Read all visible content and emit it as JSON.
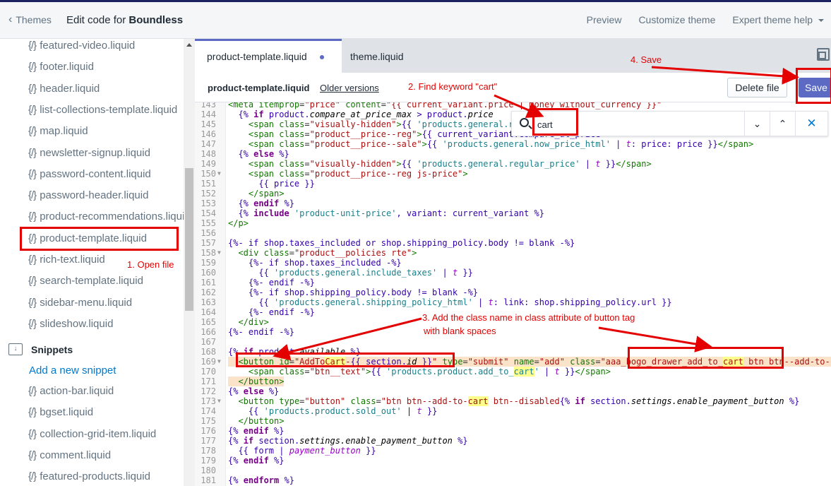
{
  "header": {
    "back_label": "Themes",
    "title_prefix": "Edit code for ",
    "title_theme": "Boundless",
    "nav": [
      "Preview",
      "Customize theme",
      "Expert theme help"
    ]
  },
  "sidebar": {
    "sections_files": [
      "featured-video.liquid",
      "footer.liquid",
      "header.liquid",
      "list-collections-template.liquid",
      "map.liquid",
      "newsletter-signup.liquid",
      "password-content.liquid",
      "password-header.liquid",
      "product-recommendations.liquid",
      "product-template.liquid",
      "rich-text.liquid",
      "search-template.liquid",
      "sidebar-menu.liquid",
      "slideshow.liquid"
    ],
    "snippets_folder": "Snippets",
    "add_snippet": "Add a new snippet",
    "snippet_files": [
      "action-bar.liquid",
      "bgset.liquid",
      "collection-grid-item.liquid",
      "comment.liquid",
      "featured-products.liquid"
    ],
    "code_icon": "{/}"
  },
  "editor": {
    "tabs": [
      {
        "label": "product-template.liquid",
        "active": true,
        "unsaved": true
      },
      {
        "label": "theme.liquid",
        "active": false
      }
    ],
    "file_name": "product-template.liquid",
    "older_versions": "Older versions",
    "delete_label": "Delete file",
    "save_label": "Save",
    "search": {
      "value": "cart",
      "next": "⌄",
      "prev": "⌃",
      "close": "✕"
    },
    "lines": [
      {
        "n": "143",
        "html": "<span class='tag'>&lt;meta</span> <span class='attr'>itemprop</span>=<span class='str'>\"price\"</span> <span class='attr'>content</span>=<span class='str'>\"{{ current_variant.price | money_without_currency }}\"</span>"
      },
      {
        "n": "144",
        "html": "  <span class='lq'>{%</span> <span class='kw'>if</span> <span class='lq'>product.</span><span class='prop'>compare_at_price_max</span> <span class='lq'>&gt; product.</span><span class='prop'>price</span>"
      },
      {
        "n": "145",
        "html": "    <span class='tag'>&lt;span</span> <span class='attr'>class</span>=<span class='str'>\"visually-hidden\"</span><span class='tag'>&gt;</span><span class='lq'>{{</span> <span class='q'>'products.general.regular_price'</span>"
      },
      {
        "n": "146",
        "html": "    <span class='tag'>&lt;span</span> <span class='attr'>class</span>=<span class='str'>\"product__price--reg\"</span><span class='tag'>&gt;</span><span class='lq'>{{ current_variant.compare_at_price</span>"
      },
      {
        "n": "147",
        "html": "    <span class='tag'>&lt;span</span> <span class='attr'>class</span>=<span class='str'>\"product__price--sale\"</span><span class='tag'>&gt;</span><span class='lq'>{{</span> <span class='q'>'products.general.now_price_html'</span> <span class='lq'>|</span> <span class='filter'>t</span><span class='lq'>: price: price }}</span><span class='tag'>&lt;/span&gt;</span>"
      },
      {
        "n": "148",
        "html": "  <span class='lq'>{%</span> <span class='kw'>else</span> <span class='lq'>%}</span>"
      },
      {
        "n": "149",
        "html": "    <span class='tag'>&lt;span</span> <span class='attr'>class</span>=<span class='str'>\"visually-hidden\"</span><span class='tag'>&gt;</span><span class='lq'>{{</span> <span class='q'>'products.general.regular_price'</span> <span class='lq'>|</span> <span class='filter'>t</span> <span class='lq'>}}</span><span class='tag'>&lt;/span&gt;</span>"
      },
      {
        "n": "150",
        "fold": true,
        "html": "    <span class='tag'>&lt;span</span> <span class='attr'>class</span>=<span class='str'>\"product__price--reg js-price\"</span><span class='tag'>&gt;</span>"
      },
      {
        "n": "151",
        "html": "      <span class='lq'>{{ price }}</span>"
      },
      {
        "n": "152",
        "html": "    <span class='tag'>&lt;/span&gt;</span>"
      },
      {
        "n": "153",
        "html": "  <span class='lq'>{%</span> <span class='kw'>endif</span> <span class='lq'>%}</span>"
      },
      {
        "n": "154",
        "html": "  <span class='lq'>{%</span> <span class='kw'>include</span> <span class='q'>'product-unit-price'</span><span class='lq'>, variant: current_variant %}</span>"
      },
      {
        "n": "155",
        "html": "<span class='tag'>&lt;/p&gt;</span>"
      },
      {
        "n": "156",
        "html": ""
      },
      {
        "n": "157",
        "html": "<span class='lq'>{%- if shop.taxes_included or shop.shipping_policy.body != blank -%}</span>"
      },
      {
        "n": "158",
        "fold": true,
        "html": "  <span class='tag'>&lt;div</span> <span class='attr'>class</span>=<span class='str'>\"product__policies rte\"</span><span class='tag'>&gt;</span>"
      },
      {
        "n": "159",
        "html": "    <span class='lq'>{%- if shop.taxes_included -%}</span>"
      },
      {
        "n": "160",
        "html": "      <span class='lq'>{{</span> <span class='q'>'products.general.include_taxes'</span> <span class='lq'>|</span> <span class='filter'>t</span> <span class='lq'>}}</span>"
      },
      {
        "n": "161",
        "html": "    <span class='lq'>{%- endif -%}</span>"
      },
      {
        "n": "162",
        "html": "    <span class='lq'>{%- if shop.shipping_policy.body != blank -%}</span>"
      },
      {
        "n": "163",
        "html": "      <span class='lq'>{{</span> <span class='q'>'products.general.shipping_policy_html'</span> <span class='lq'>|</span> <span class='filter'>t</span><span class='lq'>: link: shop.shipping_policy.url }}</span>"
      },
      {
        "n": "164",
        "html": "    <span class='lq'>{%- endif -%}</span>"
      },
      {
        "n": "165",
        "html": "  <span class='tag'>&lt;/div&gt;</span>"
      },
      {
        "n": "166",
        "html": "<span class='lq'>{%- endif -%}</span>"
      },
      {
        "n": "167",
        "html": ""
      },
      {
        "n": "168",
        "html": "<span class='lq'>{%</span> <span class='kw'>if</span> <span class='lq'>product.</span><span class='prop'>available</span> <span class='lq'>%}</span>"
      },
      {
        "n": "169",
        "fold": true,
        "hl": true,
        "html": "  <span class='tag'>&lt;button</span> <span class='attr'>id</span>=<span class='str'>\"AddTo<span class='match'>Cart</span>-</span><span class='lq'>{{ section.</span><span class='prop'>id</span> <span class='lq'>}}</span><span class='str'>\"</span> <span class='attr'>type</span>=<span class='str'>\"submit\"</span> <span class='attr'>name</span>=<span class='str'>\"add\"</span> <span class='attr'>class</span>=<span class='str'>\"aaa_bogo_drawer_add_to_<span class='match'>cart</span> btn btn--add-to-cart\"</span>"
      },
      {
        "n": "170",
        "html": "    <span class='tag'>&lt;span</span> <span class='attr'>class</span>=<span class='str'>\"btn__text\"</span><span class='tag'>&gt;</span><span class='lq'>{{</span> <span class='q'>'products.product.add_to_<span class='match'>cart</span>'</span> <span class='lq'>|</span> <span class='filter'>t</span> <span class='lq'>}}</span><span class='tag'>&lt;/span&gt;</span>"
      },
      {
        "n": "171",
        "hl": true,
        "html": "  <span class='tag'>&lt;/button&gt;</span>"
      },
      {
        "n": "172",
        "html": "<span class='lq'>{%</span> <span class='kw'>else</span> <span class='lq'>%}</span>"
      },
      {
        "n": "173",
        "fold": true,
        "html": "  <span class='tag'>&lt;button</span> <span class='attr'>type</span>=<span class='str'>\"button\"</span> <span class='attr'>class</span>=<span class='str'>\"btn btn--add-to-<span class='match'>cart</span> btn--disabled</span><span class='lq'>{%</span> <span class='kw'>if</span> <span class='lq'>section.</span><span class='prop'>settings.enable_payment_button</span> <span class='lq'>%}</span>"
      },
      {
        "n": "174",
        "html": "    <span class='lq'>{{</span> <span class='q'>'products.product.sold_out'</span> <span class='lq'>|</span> <span class='filter'>t</span> <span class='lq'>}}</span>"
      },
      {
        "n": "175",
        "html": "  <span class='tag'>&lt;/button&gt;</span>"
      },
      {
        "n": "176",
        "html": "<span class='lq'>{%</span> <span class='kw'>endif</span> <span class='lq'>%}</span>"
      },
      {
        "n": "177",
        "html": "<span class='lq'>{%</span> <span class='kw'>if</span> <span class='lq'>section.</span><span class='prop'>settings.enable_payment_button</span> <span class='lq'>%}</span>"
      },
      {
        "n": "178",
        "html": "  <span class='lq'>{{ form |</span> <span class='filter'>payment_button</span> <span class='lq'>}}</span>"
      },
      {
        "n": "179",
        "html": "<span class='lq'>{%</span> <span class='kw'>endif</span> <span class='lq'>%}</span>"
      },
      {
        "n": "180",
        "html": ""
      },
      {
        "n": "181",
        "html": "<span class='lq'>{%</span> <span class='kw'>endform</span> <span class='lq'>%}</span>"
      }
    ]
  },
  "annotations": {
    "step1": "1. Open file",
    "step2": "2. Find keyword \"cart\"",
    "step3_line1": "3. Add the class name in class attribute of button tag",
    "step3_line2": "with blank spaces",
    "step4": "4. Save",
    "color": "#e50000"
  },
  "colors": {
    "accent": "#5c6ac4",
    "link": "#007ace",
    "header_bg": "#f4f6f8",
    "top_strip": "#1c2260",
    "highlight_line": "#fbe3c9",
    "search_match": "#ffff8c"
  }
}
